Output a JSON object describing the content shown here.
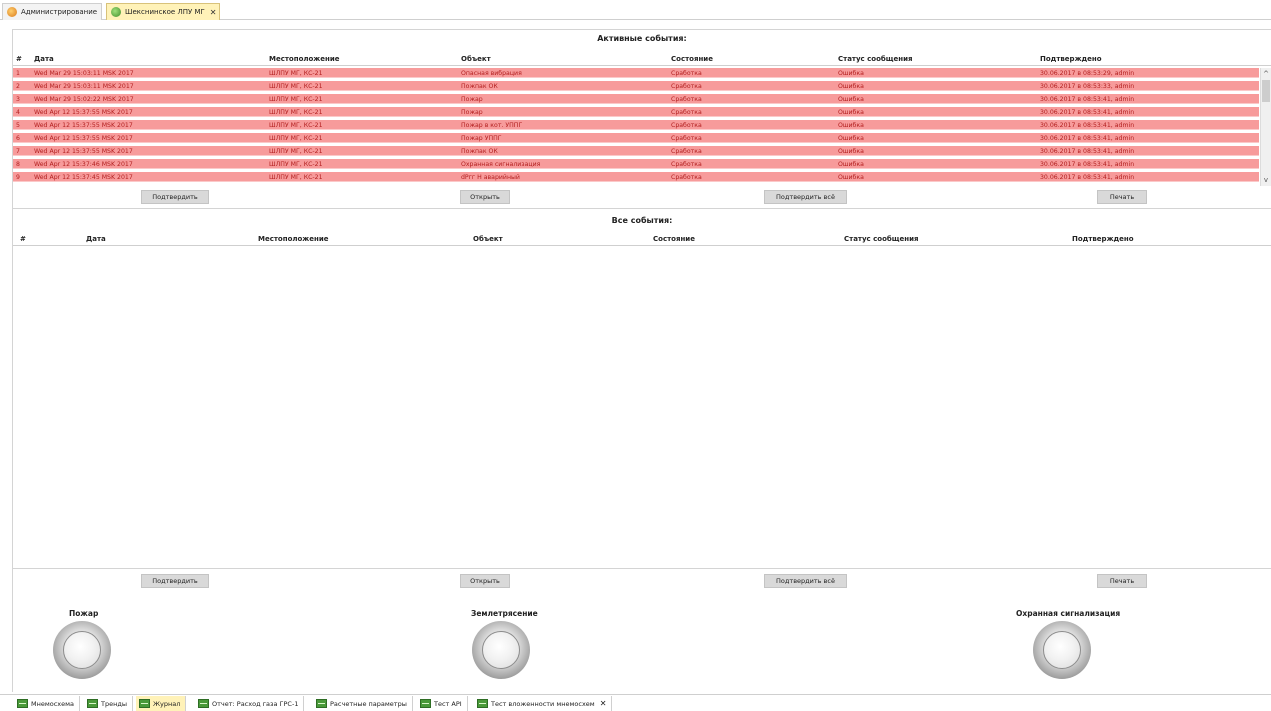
{
  "top_tabs": [
    {
      "label": "Администрирование",
      "icon": "admin-icon",
      "active": false
    },
    {
      "label": "Шекснинское ЛПУ МГ",
      "icon": "station-icon",
      "active": true
    }
  ],
  "active_events": {
    "title": "Активные события:",
    "columns": [
      "#",
      "Дата",
      "Местоположение",
      "Объект",
      "Состояние",
      "Статус сообщения",
      "Подтверждено"
    ],
    "rows": [
      [
        "1",
        "Wed Mar 29 15:03:11 MSK 2017",
        "ШЛПУ МГ, КС-21",
        "Опасная вибрация",
        "Сработка",
        "Ошибка",
        "30.06.2017 в 08:53:29, admin"
      ],
      [
        "2",
        "Wed Mar 29 15:03:11 MSK 2017",
        "ШЛПУ МГ, КС-21",
        "Пожпак ОК",
        "Сработка",
        "Ошибка",
        "30.06.2017 в 08:53:33, admin"
      ],
      [
        "3",
        "Wed Mar 29 15:02:22 MSK 2017",
        "ШЛПУ МГ, КС-21",
        "Пожар",
        "Сработка",
        "Ошибка",
        "30.06.2017 в 08:53:41, admin"
      ],
      [
        "4",
        "Wed Apr 12 15:37:55 MSK 2017",
        "ШЛПУ МГ, КС-21",
        "Пожар",
        "Сработка",
        "Ошибка",
        "30.06.2017 в 08:53:41, admin"
      ],
      [
        "5",
        "Wed Apr 12 15:37:55 MSK 2017",
        "ШЛПУ МГ, КС-21",
        "Пожар в кот. УППГ",
        "Сработка",
        "Ошибка",
        "30.06.2017 в 08:53:41, admin"
      ],
      [
        "6",
        "Wed Apr 12 15:37:55 MSK 2017",
        "ШЛПУ МГ, КС-21",
        "Пожар УППГ",
        "Сработка",
        "Ошибка",
        "30.06.2017 в 08:53:41, admin"
      ],
      [
        "7",
        "Wed Apr 12 15:37:55 MSK 2017",
        "ШЛПУ МГ, КС-21",
        "Пожпак ОК",
        "Сработка",
        "Ошибка",
        "30.06.2017 в 08:53:41, admin"
      ],
      [
        "8",
        "Wed Apr 12 15:37:46 MSK 2017",
        "ШЛПУ МГ, КС-21",
        "Охранная сигнализация",
        "Сработка",
        "Ошибка",
        "30.06.2017 в 08:53:41, admin"
      ],
      [
        "9",
        "Wed Apr 12 15:37:45 MSK 2017",
        "ШЛПУ МГ, КС-21",
        "dРгг Н аварийный",
        "Сработка",
        "Ошибка",
        "30.06.2017 в 08:53:41, admin"
      ]
    ],
    "buttons": {
      "confirm": "Подтвердить",
      "open": "Открыть",
      "confirm_all": "Подтвердить всё",
      "print": "Печать"
    }
  },
  "all_events": {
    "title": "Все события:",
    "columns": [
      "#",
      "Дата",
      "Местоположение",
      "Объект",
      "Состояние",
      "Статус сообщения",
      "Подтверждено"
    ],
    "buttons": {
      "confirm": "Подтвердить",
      "open": "Открыть",
      "confirm_all": "Подтвердить всё",
      "print": "Печать"
    }
  },
  "indicators": [
    {
      "label": "Пожар"
    },
    {
      "label": "Землетрясение"
    },
    {
      "label": "Охранная сигнализация"
    }
  ],
  "bottom_tabs": [
    {
      "label": "Мнемосхема",
      "active": false
    },
    {
      "label": "Тренды",
      "active": false
    },
    {
      "label": "Журнал",
      "active": true
    },
    {
      "label": "Отчет: Расход газа ГРС-1",
      "active": false
    },
    {
      "label": "Расчетные параметры",
      "active": false
    },
    {
      "label": "Тест API",
      "active": false
    },
    {
      "label": "Тест вложенности мнемосхем",
      "active": false,
      "closable": true
    }
  ],
  "colors": {
    "row_bg": "#f79b9b",
    "row_text": "#b32020",
    "active_tab": "#fff2b8"
  }
}
